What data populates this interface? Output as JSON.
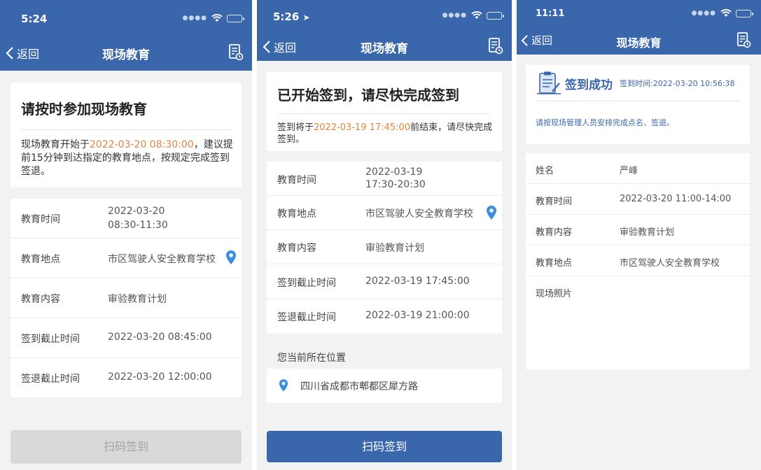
{
  "colors": {
    "nav_bg": "#3a67ab",
    "highlight": "#e5843f",
    "accent_blue": "#3a67ab",
    "disabled_btn": "#d9d9d9",
    "location_pin": "#3a8de0"
  },
  "screen1": {
    "status_time": "5:24",
    "back_label": "返回",
    "title": "现场教育",
    "notice_title": "请按时参加现场教育",
    "notice_pre": "现场教育开始于",
    "notice_time": "2022-03-20 08:30:00",
    "notice_post": "，建议提前15分钟到达指定的教育地点，按规定完成签到签退。",
    "rows": [
      {
        "label": "教育时间",
        "value": "2022-03-20",
        "value2": "08:30-11:30"
      },
      {
        "label": "教育地点",
        "value": "市区驾驶人安全教育学校"
      },
      {
        "label": "教育内容",
        "value": "审验教育计划"
      },
      {
        "label": "签到截止时间",
        "value": "2022-03-20 08:45:00"
      },
      {
        "label": "签退截止时间",
        "value": "2022-03-20 12:00:00"
      }
    ],
    "button_label": "扫码签到"
  },
  "screen2": {
    "status_time": "5:26",
    "back_label": "返回",
    "title": "现场教育",
    "notice_title": "已开始签到，请尽快完成签到",
    "notice_pre": "签到将于",
    "notice_time": "2022-03-19 17:45:00",
    "notice_post": "前结束，请尽快完成签到。",
    "rows": [
      {
        "label": "教育时间",
        "value": "2022-03-19",
        "value2": "17:30-20:30"
      },
      {
        "label": "教育地点",
        "value": "市区驾驶人安全教育学校"
      },
      {
        "label": "教育内容",
        "value": "审验教育计划"
      },
      {
        "label": "签到截止时间",
        "value": "2022-03-19 17:45:00"
      },
      {
        "label": "签退截止时间",
        "value": "2022-03-19 21:00:00"
      }
    ],
    "location_heading": "您当前所在位置",
    "location_value": "四川省成都市郫都区犀方路",
    "button_label": "扫码签到"
  },
  "screen3": {
    "status_time": "11:11",
    "back_label": "返回",
    "title": "现场教育",
    "success_title": "签到成功",
    "success_time": "签到时间:2022-03-20 10:56:38",
    "success_note": "请按现场管理人员安排完成点名、签退。",
    "rows": [
      {
        "label": "姓名",
        "value": "严峰"
      },
      {
        "label": "教育时间",
        "value": "2022-03-20 11:00-14:00"
      },
      {
        "label": "教育内容",
        "value": "审验教育计划"
      },
      {
        "label": "教育地点",
        "value": "市区驾驶人安全教育学校"
      },
      {
        "label": "现场照片",
        "value": ""
      }
    ]
  }
}
